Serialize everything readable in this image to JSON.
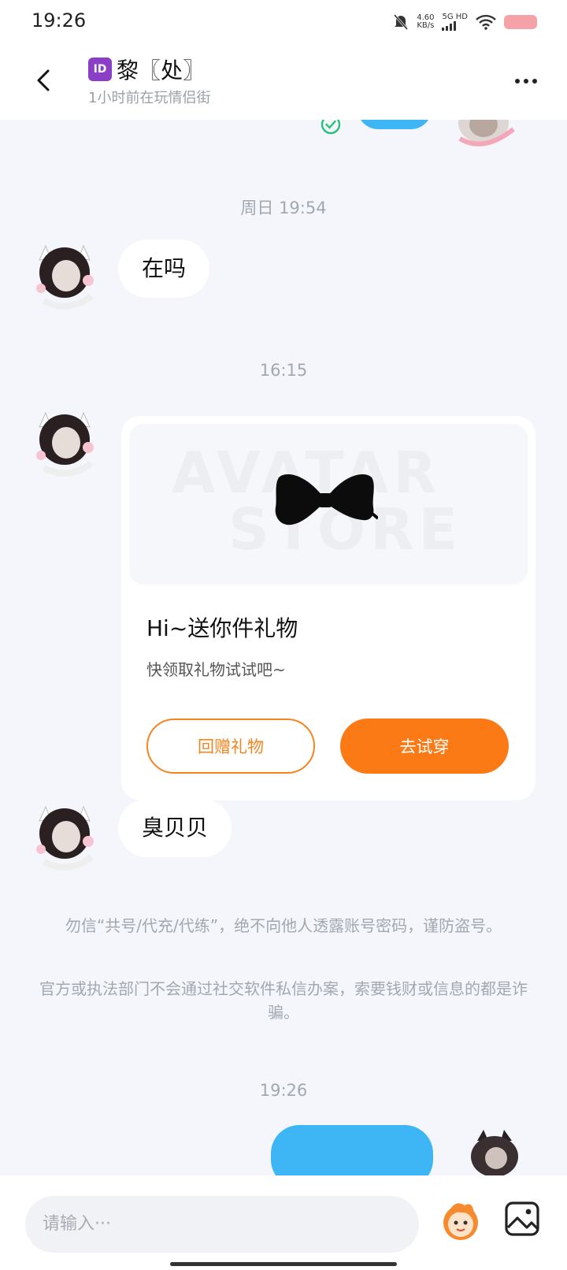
{
  "status_bar": {
    "time": "19:26",
    "net_speed": "4.60",
    "net_unit": "KB/s",
    "net_type": "5G HD"
  },
  "header": {
    "id_badge": "ID",
    "title": "黎〖处〗",
    "subtitle": "1小时前在玩情侣街"
  },
  "messages": {
    "time_1": "周日 19:54",
    "msg_1": "在吗",
    "time_2": "16:15",
    "gift_card": {
      "watermark_1": "AVATAR",
      "watermark_2": "STORE",
      "title": "Hi~送你件礼物",
      "subtitle": "快领取礼物试试吧~",
      "return_gift_label": "回赠礼物",
      "try_on_label": "去试穿"
    },
    "msg_2": "臭贝贝",
    "warning_1": "勿信“共号/代充/代练”，绝不向他人透露账号密码，谨防盗号。",
    "warning_2": "官方或执法部门不会通过社交软件私信办案，索要钱财或信息的都是诈骗。",
    "time_3": "19:26"
  },
  "input": {
    "placeholder": "请输入···"
  },
  "icons": {
    "back": "chevron-left-icon",
    "more": "more-dots-icon",
    "read": "check-circle-icon",
    "gift": "bow-icon",
    "emoji": "avatar-sticker-icon",
    "image": "image-icon"
  },
  "colors": {
    "accent_orange": "#fb7a16",
    "outgoing_bubble": "#3eb6f5",
    "id_badge": "#8b3fc7"
  }
}
